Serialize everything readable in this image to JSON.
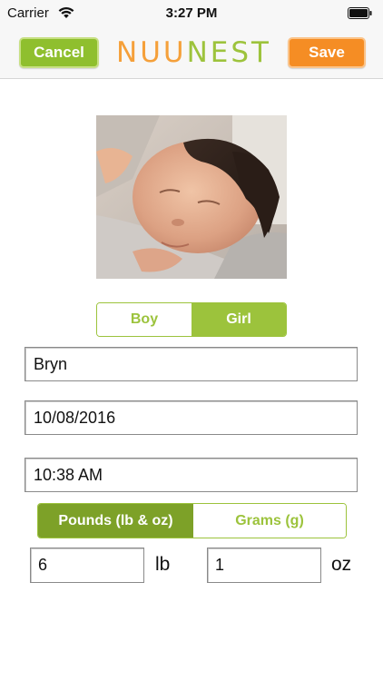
{
  "status_bar": {
    "carrier": "Carrier",
    "time": "3:27 PM"
  },
  "nav": {
    "cancel_label": "Cancel",
    "logo_part1": "NUU",
    "logo_part2": "NEST",
    "save_label": "Save"
  },
  "gender": {
    "options": [
      "Boy",
      "Girl"
    ],
    "selected": "Girl"
  },
  "form": {
    "name": "Bryn",
    "date": "10/08/2016",
    "time": "10:38 AM"
  },
  "units": {
    "options": [
      "Pounds (lb & oz)",
      "Grams (g)"
    ],
    "selected": "Pounds (lb & oz)"
  },
  "weight": {
    "lb_value": "6",
    "lb_unit": "lb",
    "oz_value": "1",
    "oz_unit": "oz"
  },
  "icons": [
    "wifi-icon",
    "battery-icon"
  ],
  "colors": {
    "green": "#9cc33c",
    "dark_green": "#7da128",
    "orange": "#f58d24"
  }
}
